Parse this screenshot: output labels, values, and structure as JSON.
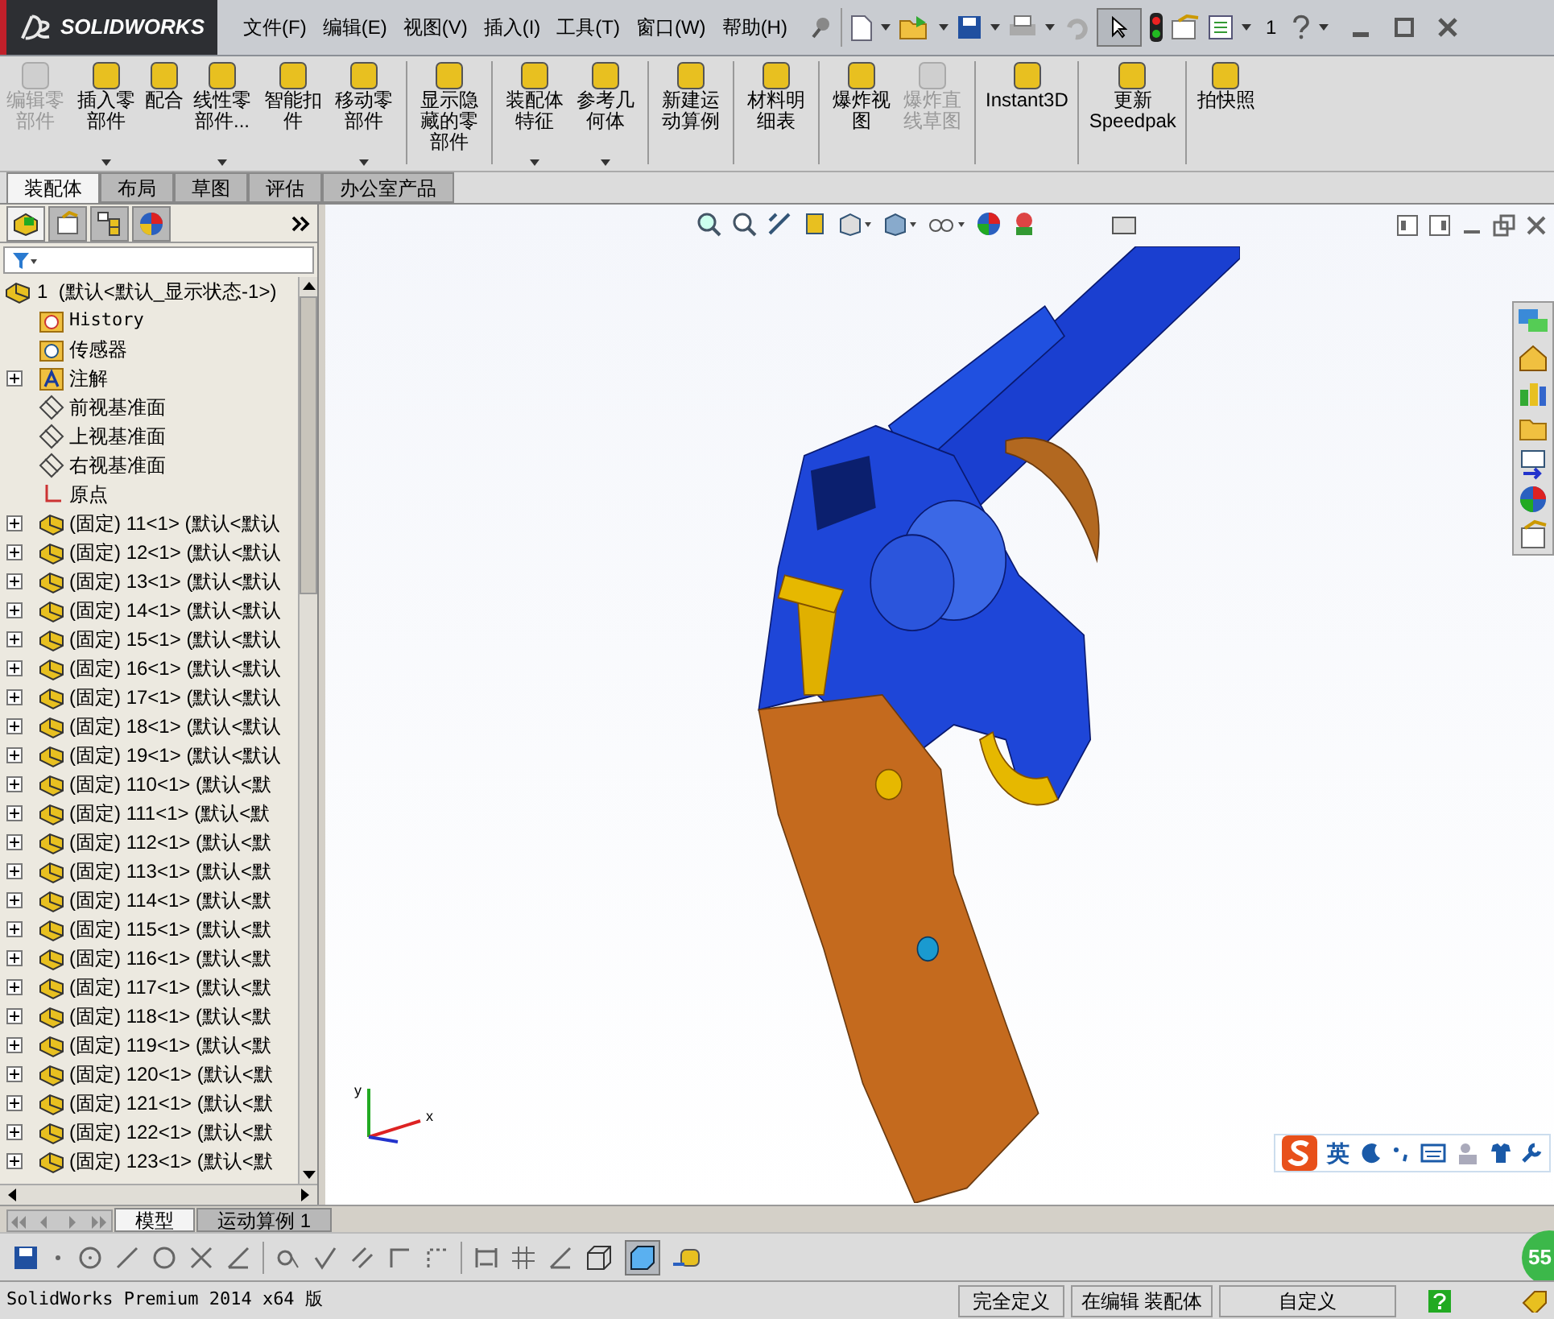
{
  "app": {
    "logo": "SOLIDWORKS",
    "menu": [
      "文件(F)",
      "编辑(E)",
      "视图(V)",
      "插入(I)",
      "工具(T)",
      "窗口(W)",
      "帮助(H)"
    ],
    "quick_count": "1"
  },
  "command_groups": [
    [
      {
        "label": "编辑零部件",
        "disabled": true,
        "dropdown": false
      },
      {
        "label": "插入零部件",
        "disabled": false,
        "dropdown": true
      },
      {
        "label": "配合",
        "disabled": false,
        "dropdown": false
      },
      {
        "label": "线性零部件...",
        "disabled": false,
        "dropdown": true
      },
      {
        "label": "智能扣件",
        "disabled": false,
        "dropdown": false
      },
      {
        "label": "移动零部件",
        "disabled": false,
        "dropdown": true
      }
    ],
    [
      {
        "label": "显示隐藏的零部件",
        "disabled": false,
        "dropdown": false
      }
    ],
    [
      {
        "label": "装配体特征",
        "disabled": false,
        "dropdown": true
      },
      {
        "label": "参考几何体",
        "disabled": false,
        "dropdown": true
      }
    ],
    [
      {
        "label": "新建运动算例",
        "disabled": false,
        "dropdown": false
      }
    ],
    [
      {
        "label": "材料明细表",
        "disabled": false,
        "dropdown": false
      }
    ],
    [
      {
        "label": "爆炸视图",
        "disabled": false,
        "dropdown": false
      },
      {
        "label": "爆炸直线草图",
        "disabled": true,
        "dropdown": false
      }
    ],
    [
      {
        "label": "Instant3D",
        "disabled": false,
        "dropdown": false
      }
    ],
    [
      {
        "label": "更新 Speedpak",
        "disabled": false,
        "dropdown": false
      }
    ],
    [
      {
        "label": "拍快照",
        "disabled": false,
        "dropdown": false
      }
    ]
  ],
  "tabs": [
    {
      "label": "装配体",
      "selected": true
    },
    {
      "label": "布局",
      "selected": false
    },
    {
      "label": "草图",
      "selected": false
    },
    {
      "label": "评估",
      "selected": false
    },
    {
      "label": "办公室产品",
      "selected": false
    }
  ],
  "tree": {
    "root": "1  (默认<默认_显示状态-1>)",
    "items": [
      {
        "kind": "history",
        "label": "History",
        "expandable": false
      },
      {
        "kind": "sensor",
        "label": "传感器",
        "expandable": false
      },
      {
        "kind": "annotation",
        "label": "注解",
        "expandable": true
      },
      {
        "kind": "plane",
        "label": "前视基准面",
        "expandable": false
      },
      {
        "kind": "plane",
        "label": "上视基准面",
        "expandable": false
      },
      {
        "kind": "plane",
        "label": "右视基准面",
        "expandable": false
      },
      {
        "kind": "origin",
        "label": "原点",
        "expandable": false
      },
      {
        "kind": "part",
        "label": "(固定) 11<1> (默认<默认",
        "expandable": true
      },
      {
        "kind": "part",
        "label": "(固定) 12<1> (默认<默认",
        "expandable": true
      },
      {
        "kind": "part",
        "label": "(固定) 13<1> (默认<默认",
        "expandable": true
      },
      {
        "kind": "part",
        "label": "(固定) 14<1> (默认<默认",
        "expandable": true
      },
      {
        "kind": "part",
        "label": "(固定) 15<1> (默认<默认",
        "expandable": true
      },
      {
        "kind": "part",
        "label": "(固定) 16<1> (默认<默认",
        "expandable": true
      },
      {
        "kind": "part",
        "label": "(固定) 17<1> (默认<默认",
        "expandable": true
      },
      {
        "kind": "part",
        "label": "(固定) 18<1> (默认<默认",
        "expandable": true
      },
      {
        "kind": "part",
        "label": "(固定) 19<1> (默认<默认",
        "expandable": true
      },
      {
        "kind": "part",
        "label": "(固定) 110<1> (默认<默",
        "expandable": true
      },
      {
        "kind": "part",
        "label": "(固定) 111<1> (默认<默",
        "expandable": true
      },
      {
        "kind": "part",
        "label": "(固定) 112<1> (默认<默",
        "expandable": true
      },
      {
        "kind": "part",
        "label": "(固定) 113<1> (默认<默",
        "expandable": true
      },
      {
        "kind": "part",
        "label": "(固定) 114<1> (默认<默",
        "expandable": true
      },
      {
        "kind": "part",
        "label": "(固定) 115<1> (默认<默",
        "expandable": true
      },
      {
        "kind": "part",
        "label": "(固定) 116<1> (默认<默",
        "expandable": true
      },
      {
        "kind": "part",
        "label": "(固定) 117<1> (默认<默",
        "expandable": true
      },
      {
        "kind": "part",
        "label": "(固定) 118<1> (默认<默",
        "expandable": true
      },
      {
        "kind": "part",
        "label": "(固定) 119<1> (默认<默",
        "expandable": true
      },
      {
        "kind": "part",
        "label": "(固定) 120<1> (默认<默",
        "expandable": true
      },
      {
        "kind": "part",
        "label": "(固定) 121<1> (默认<默",
        "expandable": true
      },
      {
        "kind": "part",
        "label": "(固定) 122<1> (默认<默",
        "expandable": true
      },
      {
        "kind": "part",
        "label": "(固定) 123<1> (默认<默",
        "expandable": true
      }
    ]
  },
  "triad": {
    "y": "y",
    "x": "x"
  },
  "bottom_tabs": [
    {
      "label": "模型",
      "selected": true
    },
    {
      "label": "运动算例 1",
      "selected": false
    }
  ],
  "ime": {
    "mode": "英"
  },
  "badge": "55",
  "status_bar": {
    "product": "SolidWorks Premium 2014 x64 版",
    "fields": [
      "完全定义",
      "在编辑 装配体",
      "自定义"
    ]
  }
}
